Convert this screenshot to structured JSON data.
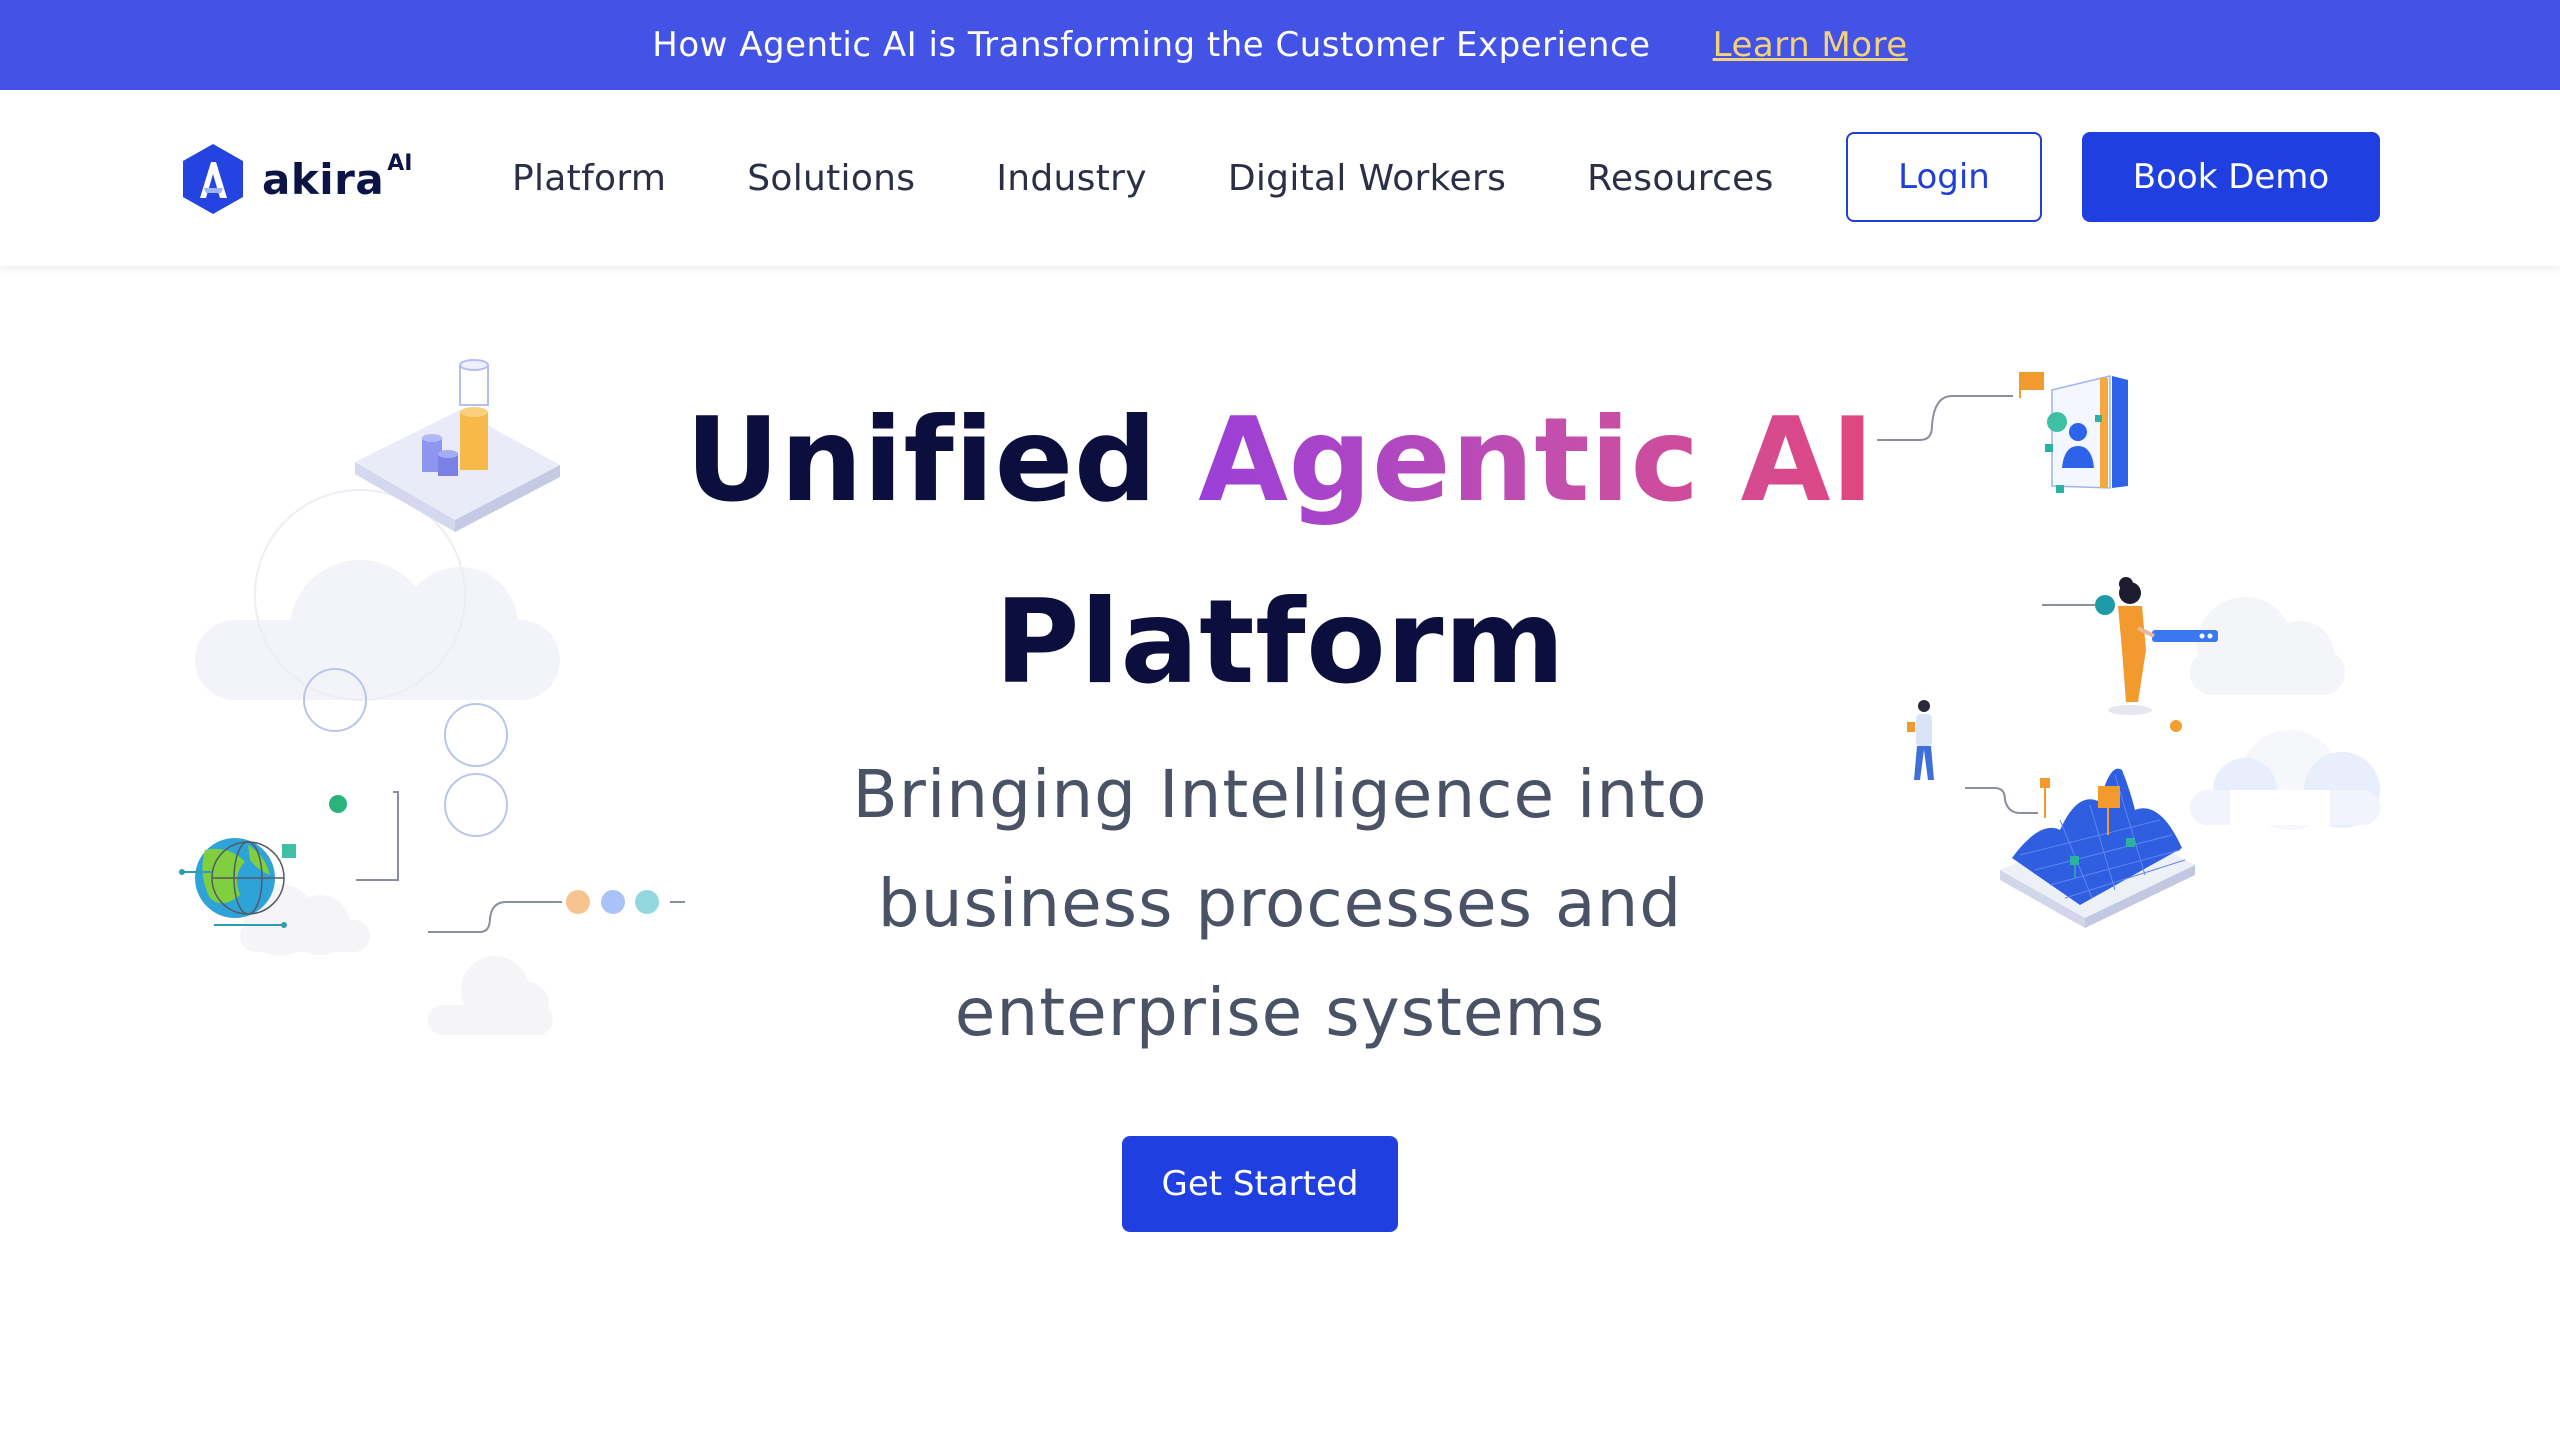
{
  "announcement": {
    "text": "How Agentic AI is Transforming the Customer Experience",
    "link_label": "Learn More"
  },
  "header": {
    "logo_text": "akira",
    "logo_superscript": "AI",
    "nav_items": [
      "Platform",
      "Solutions",
      "Industry",
      "Digital Workers",
      "Resources"
    ],
    "login_label": "Login",
    "demo_label": "Book Demo"
  },
  "hero": {
    "title_part1": "Unified ",
    "title_highlight": "Agentic AI",
    "title_part2": "Platform",
    "subtitle": "Bringing Intelligence into business processes and enterprise systems",
    "cta_label": "Get Started"
  },
  "colors": {
    "announcement_bg": "#4353e6",
    "link_color": "#f4d27a",
    "brand_blue": "#1f3fe0",
    "title_dark": "#0c0f3e",
    "gradient_start": "#9b3fd9",
    "gradient_end": "#e0477f"
  },
  "icons": {
    "logo": "akira-logo-icon",
    "left_illustration": "data-analytics-illustration",
    "right_illustration": "digital-workers-illustration"
  }
}
